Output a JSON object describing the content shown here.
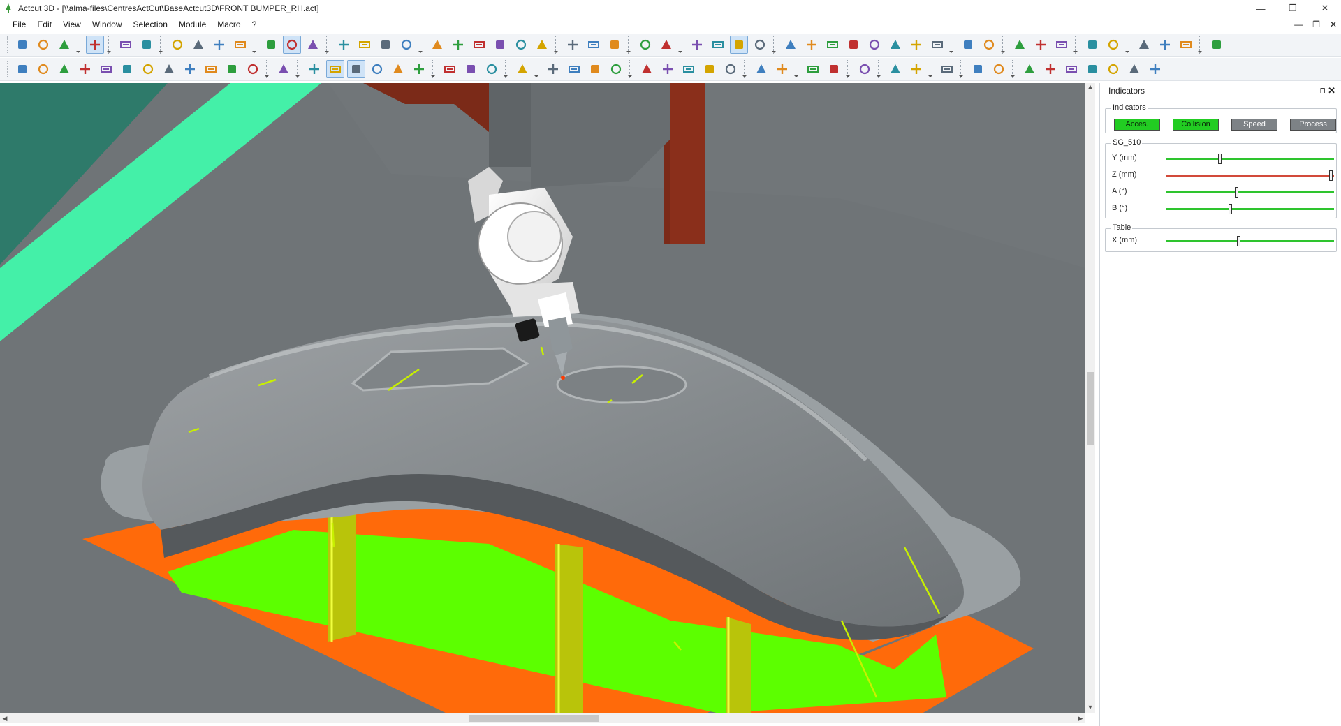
{
  "window": {
    "title": "Actcut 3D - [\\\\alma-files\\CentresActCut\\BaseActcut3D\\FRONT BUMPER_RH.act]",
    "controls": [
      "—",
      "❐",
      "✕"
    ]
  },
  "menu": {
    "items": [
      "File",
      "Edit",
      "View",
      "Window",
      "Selection",
      "Module",
      "Macro",
      "?"
    ],
    "mdi_controls": [
      "—",
      "❐",
      "✕"
    ]
  },
  "colors": {
    "viewport_bg": "#6e7376",
    "floor": "#6f7477",
    "part": "#8a8f92",
    "fixture": "#5cff00",
    "base_plate": "#ff6a0a",
    "machine_wall": "#7b2a18",
    "mint": "#44f0a8",
    "indicator_green": "#22cc22",
    "indicator_gray": "#7d8286",
    "slider_green": "#2ec42e",
    "slider_red": "#d24a3a"
  },
  "panel": {
    "title": "Indicators",
    "pin": "⊓",
    "close": "✕",
    "indicators_group": {
      "title": "Indicators",
      "buttons": [
        {
          "label": "Acces.",
          "state": "green"
        },
        {
          "label": "Collision",
          "state": "green"
        },
        {
          "label": "Speed",
          "state": "gray"
        },
        {
          "label": "Process",
          "state": "gray"
        }
      ]
    },
    "sg_group": {
      "title": "SG_510",
      "axes": [
        {
          "label": "Y (mm)",
          "value": 0.31,
          "color": "green"
        },
        {
          "label": "Z (mm)",
          "value": 0.97,
          "color": "red"
        },
        {
          "label": "A (°)",
          "value": 0.41,
          "color": "green"
        },
        {
          "label": "B (°)",
          "value": 0.37,
          "color": "green"
        }
      ]
    },
    "table_group": {
      "title": "Table",
      "axes": [
        {
          "label": "X (mm)",
          "value": 0.42,
          "color": "green"
        }
      ]
    }
  },
  "scroll": {
    "up_arrow": "▲",
    "down_arrow": "▼",
    "left_arrow": "◀",
    "right_arrow": "▶"
  },
  "toolbar_icons": {
    "row1": [
      "new-file-icon",
      "open-folder-icon",
      "save-icon",
      "|",
      "select-arrow-icon",
      "|",
      "undo-icon",
      "redo-icon",
      "|",
      "trim-icon",
      "extend-icon",
      "curve-icon",
      "path-icon",
      "|",
      "shaded-view-icon",
      "shaded-edge-view-icon",
      "color-view-icon",
      "|",
      "rotate-view-icon",
      "pan-icon",
      "zoom-in-icon",
      "zoom-out-icon",
      "|",
      "view-front-icon",
      "view-back-icon",
      "view-left-icon",
      "view-right-icon",
      "view-top-icon",
      "view-bottom-icon",
      "|",
      "fit-all-icon",
      "view-iso-icon",
      "view-window-icon",
      "|",
      "visibility-icon",
      "camera-icon",
      "|",
      "tool-path-icon",
      "fill-color-icon",
      "grid-icon",
      "flag-icon",
      "|",
      "axis-icon",
      "target-icon",
      "gear-pair-icon",
      "plane-icon",
      "cut-icon",
      "rotate-part-icon",
      "move-part-icon",
      "part-b-icon",
      "|",
      "sheet-icon",
      "sheet-b-icon",
      "|",
      "shear-icon",
      "shear-b-icon",
      "laser-icon",
      "|",
      "export-icon",
      "export-b-icon",
      "|",
      "assembly-icon",
      "assembly-b-icon",
      "assembly-c-icon",
      "|",
      "settings-gear-icon"
    ],
    "row2": [
      "bulk-icon",
      "tool-a-icon",
      "tool-b-icon",
      "refresh-icon",
      "line-icon",
      "move-icon",
      "pencil-icon",
      "text-tool-icon",
      "clamp-icon",
      "clamp-b-icon",
      "clamp-c-icon",
      "ruler-icon",
      "|",
      "list-icon",
      "|",
      "bulb-icon",
      "bulb-edit-icon",
      "bulb-3d-icon",
      "bulb-settings-icon",
      "bulb-multi-icon",
      "bulb-grid-icon",
      "|",
      "sensor-icon",
      "sensor-b-icon",
      "auto-icon",
      "|",
      "columns-icon",
      "|",
      "list-b-icon",
      "list-c-icon",
      "list-up-icon",
      "list-x-icon",
      "|",
      "arrow-left-icon",
      "arrow-right-icon",
      "page-icon",
      "list-d-icon",
      "list-e-icon",
      "|",
      "xyz-icon",
      "paint-icon",
      "|",
      "box-icon",
      "cut-tool-icon",
      "|",
      "machine-icon",
      "|",
      "align-icon",
      "align-b-icon",
      "|",
      "table-icon",
      "|",
      "flow-icon",
      "flow-b-icon",
      "|",
      "play-back-icon",
      "stop-icon",
      "fast-forward-icon",
      "play-icon",
      "pause-icon",
      "skip-icon",
      "collision-stop-icon"
    ]
  }
}
